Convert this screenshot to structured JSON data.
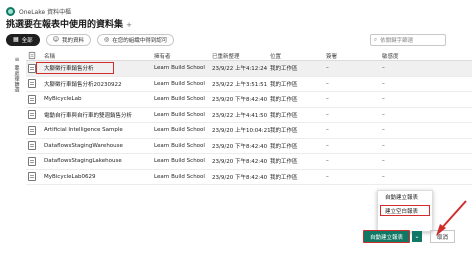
{
  "header": {
    "app_title": "OneLake 資料中樞"
  },
  "page": {
    "title": "挑選要在報表中使用的資料集",
    "title_plus": "+"
  },
  "filters": [
    {
      "label": "全部",
      "icon": "grid-icon",
      "active": true
    },
    {
      "label": "我的資料",
      "icon": "person-icon",
      "active": false
    },
    {
      "label": "在您的組織中得到認可",
      "icon": "badge-icon",
      "active": false
    }
  ],
  "search": {
    "placeholder": "依關鍵字篩選"
  },
  "side": {
    "label": "要處理篩選"
  },
  "table": {
    "headers": [
      "名稱",
      "擁有者",
      "已重新整理",
      "位置",
      "簽署",
      "敏感度"
    ],
    "rows": [
      {
        "name": "大腳徵行車銷售分析",
        "owner": "Learn Build School",
        "updated": "23/9/22 上午4:12:24",
        "location": "我的工作區",
        "endorse": "–",
        "sensitivity": "–"
      },
      {
        "name": "大腳徵行車銷售分析20230922",
        "owner": "Learn Build School",
        "updated": "23/9/22 上午3:51:51",
        "location": "我的工作區",
        "endorse": "–",
        "sensitivity": "–"
      },
      {
        "name": "MyBicycleLab",
        "owner": "Learn Build School",
        "updated": "23/9/20 下午8:42:40",
        "location": "我的工作區",
        "endorse": "–",
        "sensitivity": "–"
      },
      {
        "name": "電動自行車與自行車的雙週銷售分析",
        "owner": "Learn Build School",
        "updated": "23/9/22 上午4:41:50",
        "location": "我的工作區",
        "endorse": "–",
        "sensitivity": "–"
      },
      {
        "name": "Artificial Intelligence Sample",
        "owner": "Learn Build School",
        "updated": "23/9/20 上午10:04:21",
        "location": "我的工作區",
        "endorse": "–",
        "sensitivity": "–"
      },
      {
        "name": "DataflowsStagingWarehouse",
        "owner": "Learn Build School",
        "updated": "23/9/20 下午8:42:40",
        "location": "我的工作區",
        "endorse": "–",
        "sensitivity": "–"
      },
      {
        "name": "DataflowsStagingLakehouse",
        "owner": "Learn Build School",
        "updated": "23/9/20 下午8:42:40",
        "location": "我的工作區",
        "endorse": "–",
        "sensitivity": "–"
      },
      {
        "name": "MyBicycleLab0629",
        "owner": "Learn Build School",
        "updated": "23/9/20 下午8:42:40",
        "location": "我的工作區",
        "endorse": "–",
        "sensitivity": "–"
      }
    ]
  },
  "menu": {
    "items": [
      "自動建立報表",
      "建立空白報表"
    ]
  },
  "buttons": {
    "primary": "自動建立報表",
    "cancel": "取消"
  },
  "colors": {
    "accent": "#117865",
    "highlight": "#d22d2d"
  }
}
